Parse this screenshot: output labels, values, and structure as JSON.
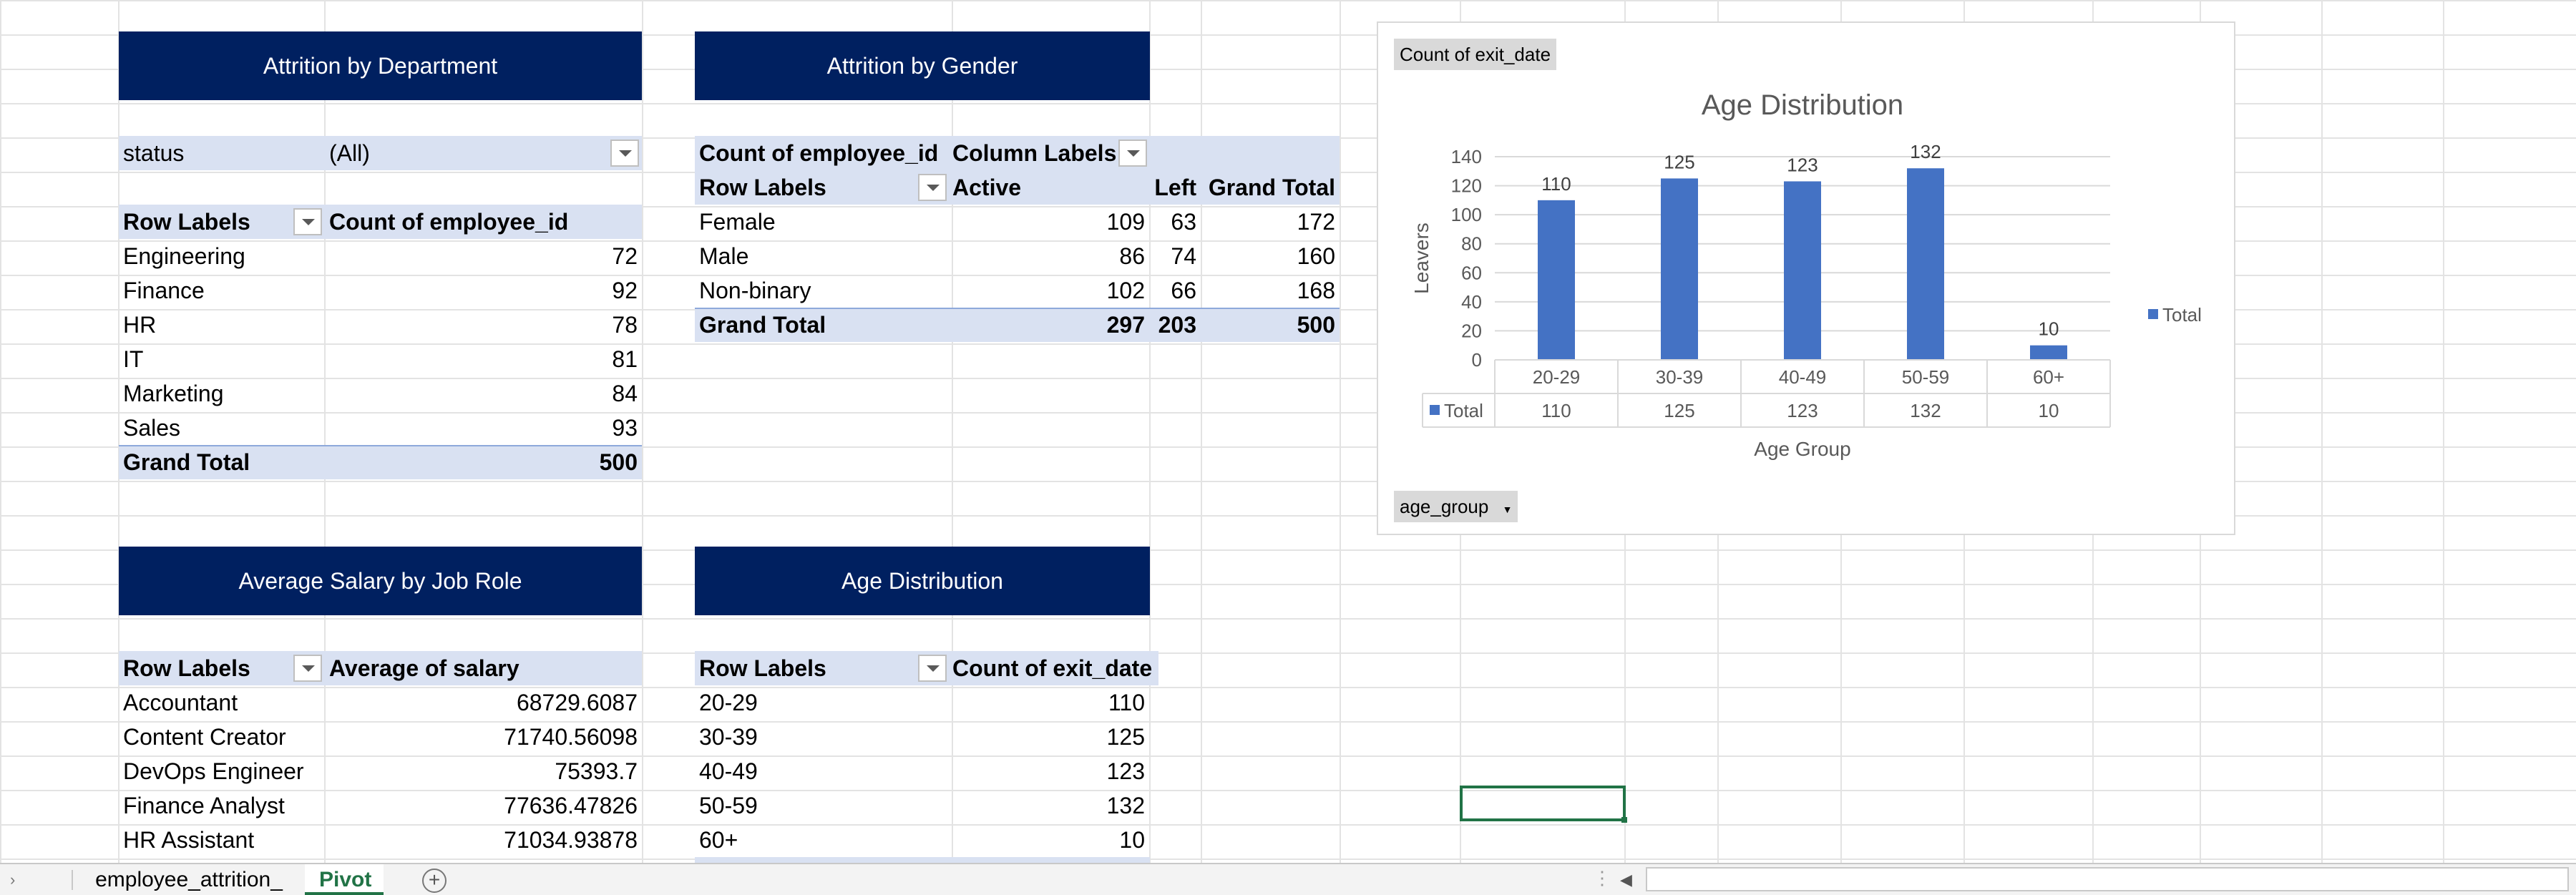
{
  "dept": {
    "header": "Attrition by Department",
    "filter_label": "status",
    "filter_value": "(All)",
    "row_labels": "Row Labels",
    "value_header": "Count of employee_id",
    "rows": [
      {
        "label": "Engineering",
        "value": "72"
      },
      {
        "label": "Finance",
        "value": "92"
      },
      {
        "label": "HR",
        "value": "78"
      },
      {
        "label": "IT",
        "value": "81"
      },
      {
        "label": "Marketing",
        "value": "84"
      },
      {
        "label": "Sales",
        "value": "93"
      }
    ],
    "total_label": "Grand Total",
    "total_value": "500"
  },
  "gender": {
    "header": "Attrition by Gender",
    "value_header": "Count of employee_id",
    "column_labels": "Column Labels",
    "row_labels": "Row Labels",
    "col_active": "Active",
    "col_left": "Left",
    "col_total": "Grand Total",
    "rows": [
      {
        "label": "Female",
        "active": "109",
        "left": "63",
        "total": "172"
      },
      {
        "label": "Male",
        "active": "86",
        "left": "74",
        "total": "160"
      },
      {
        "label": "Non-binary",
        "active": "102",
        "left": "66",
        "total": "168"
      }
    ],
    "total_label": "Grand Total",
    "total_active": "297",
    "total_left": "203",
    "total_total": "500"
  },
  "salary": {
    "header": "Average Salary by Job Role",
    "row_labels": "Row Labels",
    "value_header": "Average of salary",
    "rows": [
      {
        "label": "Accountant",
        "value": "68729.6087"
      },
      {
        "label": "Content Creator",
        "value": "71740.56098"
      },
      {
        "label": "DevOps Engineer",
        "value": "75393.7"
      },
      {
        "label": "Finance Analyst",
        "value": "77636.47826"
      },
      {
        "label": "HR Assistant",
        "value": "71034.93878"
      }
    ]
  },
  "age": {
    "header": "Age Distribution",
    "row_labels": "Row Labels",
    "value_header": "Count of exit_date",
    "rows": [
      {
        "label": "20-29",
        "value": "110"
      },
      {
        "label": "30-39",
        "value": "125"
      },
      {
        "label": "40-49",
        "value": "123"
      },
      {
        "label": "50-59",
        "value": "132"
      },
      {
        "label": "60+",
        "value": "10"
      }
    ]
  },
  "chart_buttons": {
    "value_field": "Count of exit_date",
    "axis_field": "age_group"
  },
  "chart_data": {
    "type": "bar",
    "title": "Age Distribution",
    "xlabel": "Age Group",
    "ylabel": "Leavers",
    "categories": [
      "20-29",
      "30-39",
      "40-49",
      "50-59",
      "60+"
    ],
    "series": [
      {
        "name": "Total",
        "values": [
          110,
          125,
          123,
          132,
          10
        ]
      }
    ],
    "ylim": [
      0,
      140
    ],
    "yticks": [
      0,
      20,
      40,
      60,
      80,
      100,
      120,
      140
    ],
    "data_labels": true,
    "data_table": true,
    "grid": true,
    "legend": "right",
    "bar_color": "#4472c4"
  },
  "tabs": {
    "sheet1": "employee_attrition_",
    "sheet2": "Pivot",
    "add": "+"
  },
  "colors": {
    "header_bg": "#002060",
    "band": "#d9e1f2",
    "active_tab": "#217346"
  }
}
